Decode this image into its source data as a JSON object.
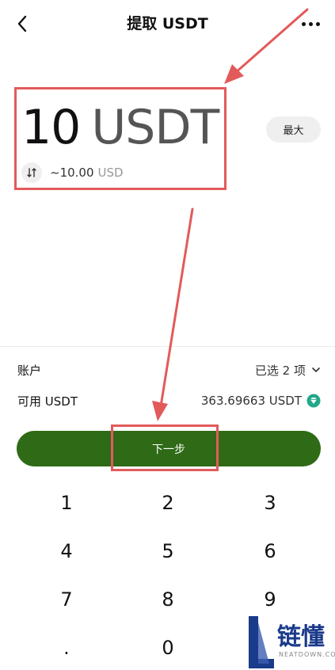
{
  "header": {
    "title": "提取 USDT",
    "back_icon": "chevron-left-icon",
    "more_icon": "more-horizontal-icon"
  },
  "amount": {
    "value": "10",
    "currency": "USDT",
    "usd_value": "~10.00",
    "usd_unit": "USD",
    "swap_icon": "swap-icon"
  },
  "max_label": "最大",
  "account_row": {
    "label": "账户",
    "value": "已选 2 项"
  },
  "available_row": {
    "label": "可用 USDT",
    "value": "363.69663 USDT",
    "icon": "gem-icon"
  },
  "next_label": "下一步",
  "keypad": {
    "keys": [
      "1",
      "2",
      "3",
      "4",
      "5",
      "6",
      "7",
      "8",
      "9",
      ".",
      "0",
      ""
    ]
  },
  "watermark": {
    "text": "链懂",
    "sub": "NEATDOWN.COM"
  },
  "colors": {
    "primary_button": "#2f6a16",
    "annotation": "#e35a5a",
    "pill_bg": "#efefef"
  }
}
